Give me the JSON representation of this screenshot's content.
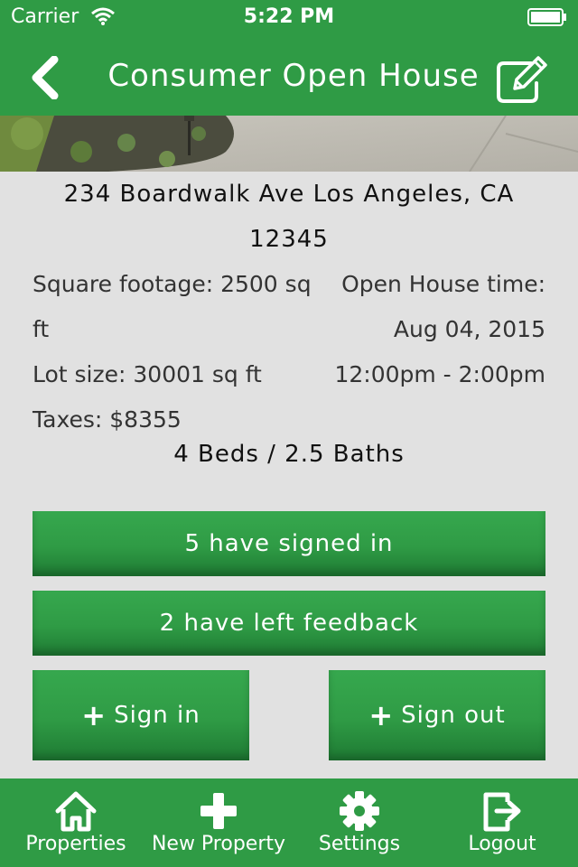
{
  "status_bar": {
    "carrier": "Carrier",
    "time": "5:22 PM"
  },
  "nav": {
    "title": "Consumer Open House",
    "back_icon": "chevron-left-icon",
    "edit_icon": "edit-icon"
  },
  "property": {
    "address": "234 Boardwalk Ave Los Angeles, CA 12345",
    "square_footage": "Square footage: 2500 sq ft",
    "lot_size": "Lot size: 30001 sq ft",
    "taxes": "Taxes: $8355",
    "open_house_label": "Open House time:",
    "open_house_date": "Aug 04, 2015",
    "open_house_hours": "12:00pm - 2:00pm",
    "beds_baths": "4 Beds / 2.5 Baths"
  },
  "actions": {
    "signed_in": "5 have signed in",
    "feedback": "2 have left feedback",
    "sign_in": "Sign in",
    "sign_out": "Sign out"
  },
  "tabs": [
    {
      "label": "Properties",
      "icon": "home-icon"
    },
    {
      "label": "New Property",
      "icon": "plus-icon"
    },
    {
      "label": "Settings",
      "icon": "gear-icon"
    },
    {
      "label": "Logout",
      "icon": "logout-icon"
    }
  ],
  "colors": {
    "brand_green": "#2f9b45",
    "background": "#e1e1e1"
  }
}
